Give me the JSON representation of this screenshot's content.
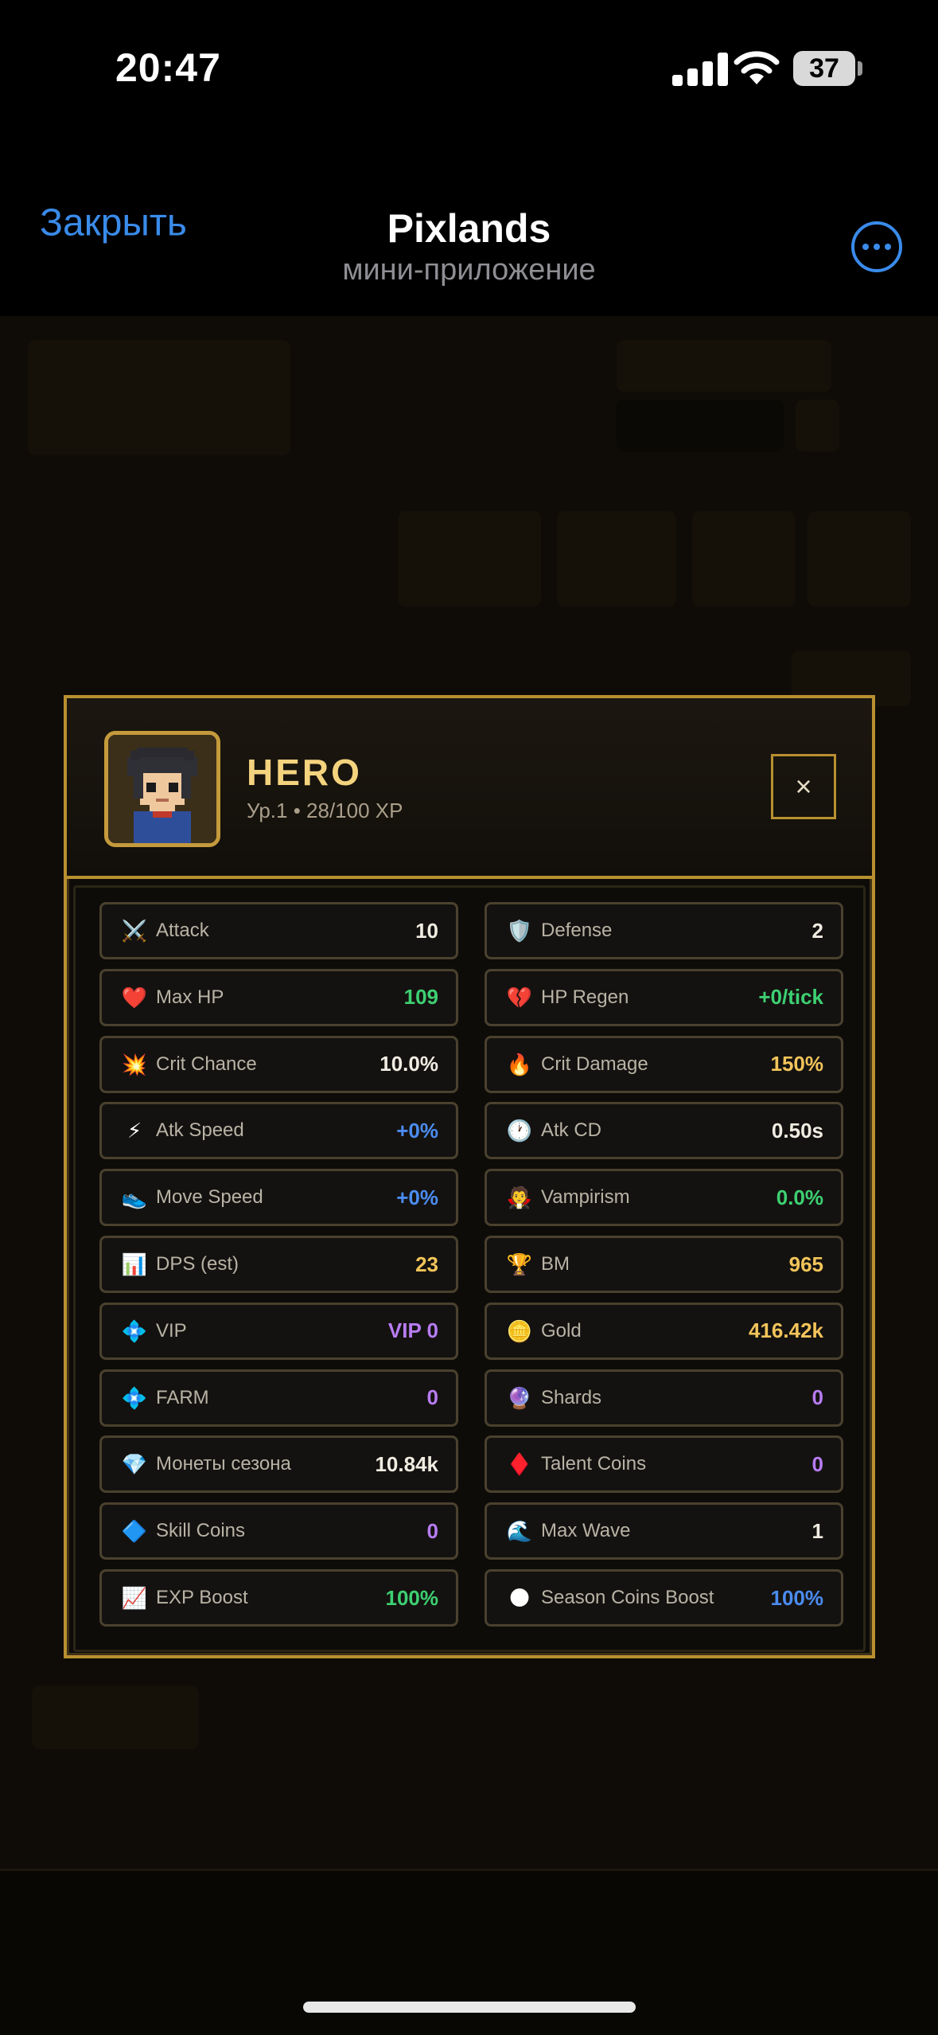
{
  "status_bar": {
    "time": "20:47",
    "battery": "37"
  },
  "nav": {
    "close_label": "Закрыть",
    "title": "Pixlands",
    "subtitle": "мини-приложение",
    "more_icon": "ellipsis-circle-icon"
  },
  "modal": {
    "hero_name": "HERO",
    "hero_level": "Ур.1 • 28/100 XP",
    "close_symbol": "×",
    "stats": [
      {
        "icon": "⚔️",
        "icon_name": "sword-icon",
        "label": "Attack",
        "value": "10",
        "color": "#f1ece2"
      },
      {
        "icon": "🛡️",
        "icon_name": "shield-icon",
        "label": "Defense",
        "value": "2",
        "color": "#f1ece2"
      },
      {
        "icon": "❤️",
        "icon_name": "heart-icon",
        "label": "Max HP",
        "value": "109",
        "color": "#3dd072"
      },
      {
        "icon": "💔",
        "icon_name": "broken-heart-icon",
        "label": "HP Regen",
        "value": "+0/tick",
        "color": "#3dd072"
      },
      {
        "icon": "💥",
        "icon_name": "collision-icon",
        "label": "Crit Chance",
        "value": "10.0%",
        "color": "#f1ece2"
      },
      {
        "icon": "🔥",
        "icon_name": "fire-icon",
        "label": "Crit Damage",
        "value": "150%",
        "color": "#f2c45a"
      },
      {
        "icon": "⚡",
        "icon_name": "lightning-icon",
        "label": "Atk Speed",
        "value": "+0%",
        "color": "#4b8cf0"
      },
      {
        "icon": "🕐",
        "icon_name": "clock-icon",
        "label": "Atk CD",
        "value": "0.50s",
        "color": "#f1ece2"
      },
      {
        "icon": "👟",
        "icon_name": "shoe-icon",
        "label": "Move Speed",
        "value": "+0%",
        "color": "#4b8cf0"
      },
      {
        "icon": "🧛",
        "icon_name": "vampire-icon",
        "label": "Vampirism",
        "value": "0.0%",
        "color": "#3dd072"
      },
      {
        "icon": "📊",
        "icon_name": "bar-chart-icon",
        "label": "DPS (est)",
        "value": "23",
        "color": "#f2c45a"
      },
      {
        "icon": "🏆",
        "icon_name": "trophy-icon",
        "label": "BM",
        "value": "965",
        "color": "#f2c45a"
      },
      {
        "icon": "💠",
        "icon_name": "diamond-icon",
        "label": "VIP",
        "value": "VIP 0",
        "color": "#b77cf2"
      },
      {
        "icon": "🪙",
        "icon_name": "coin-icon",
        "label": "Gold",
        "value": "416.42k",
        "color": "#f2c45a"
      },
      {
        "icon": "💠",
        "icon_name": "diamond-icon",
        "label": "FARM",
        "value": "0",
        "color": "#b77cf2"
      },
      {
        "icon": "🔮",
        "icon_name": "crystal-icon",
        "label": "Shards",
        "value": "0",
        "color": "#b77cf2"
      },
      {
        "icon": "💎",
        "icon_name": "gem-icon",
        "label": "Монеты сезона",
        "value": "10.84k",
        "color": "#f1ece2"
      },
      {
        "icon": "♦️",
        "icon_name": "ruby-icon",
        "label": "Talent Coins",
        "value": "0",
        "color": "#b77cf2"
      },
      {
        "icon": "🔷",
        "icon_name": "blue-diamond-icon",
        "label": "Skill Coins",
        "value": "0",
        "color": "#b77cf2"
      },
      {
        "icon": "🌊",
        "icon_name": "wave-icon",
        "label": "Max Wave",
        "value": "1",
        "color": "#f1ece2"
      },
      {
        "icon": "📈",
        "icon_name": "trend-chart-icon",
        "label": "EXP Boost",
        "value": "100%",
        "color": "#3dd072"
      },
      {
        "icon": "🌑",
        "icon_name": "moon-icon",
        "label": "Season Coins Boost",
        "value": "100%",
        "color": "#4b8cf0"
      }
    ]
  }
}
